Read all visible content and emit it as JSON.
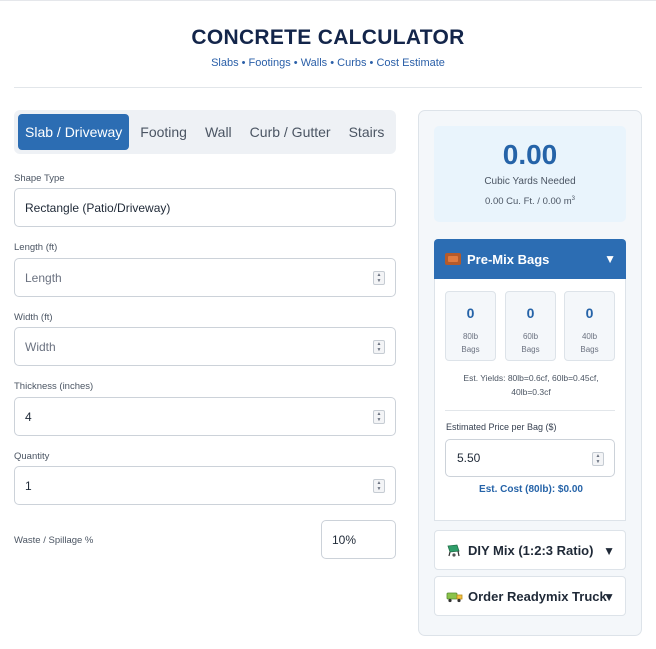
{
  "header": {
    "title": "CONCRETE CALCULATOR",
    "subtitle": "Slabs • Footings • Walls • Curbs • Cost Estimate"
  },
  "tabs": [
    {
      "label": "Slab / Driveway",
      "active": true
    },
    {
      "label": "Footing",
      "active": false
    },
    {
      "label": "Wall",
      "active": false
    },
    {
      "label": "Curb / Gutter",
      "active": false
    },
    {
      "label": "Stairs",
      "active": false
    }
  ],
  "form": {
    "shape_type": {
      "label": "Shape Type",
      "value": "Rectangle (Patio/Driveway)"
    },
    "length": {
      "label": "Length (ft)",
      "placeholder": "Length",
      "value": ""
    },
    "width": {
      "label": "Width (ft)",
      "placeholder": "Width",
      "value": ""
    },
    "thickness": {
      "label": "Thickness (inches)",
      "value": "4"
    },
    "quantity": {
      "label": "Quantity",
      "value": "1"
    },
    "waste": {
      "label": "Waste / Spillage %",
      "value": "10%"
    }
  },
  "result": {
    "value": "0.00",
    "unit": "Cubic Yards Needed",
    "sub_prefix": "0.00 Cu. Ft. / 0.00 m",
    "sub_exp": "3"
  },
  "premix": {
    "title": "Pre-Mix Bags",
    "bags": [
      {
        "count": "0",
        "label1": "80lb",
        "label2": "Bags"
      },
      {
        "count": "0",
        "label1": "60lb",
        "label2": "Bags"
      },
      {
        "count": "0",
        "label1": "40lb",
        "label2": "Bags"
      }
    ],
    "yields_line1": "Est. Yields: 80lb=0.6cf, 60lb=0.45cf,",
    "yields_line2": "40lb=0.3cf",
    "price_label": "Estimated Price per Bag ($)",
    "price_value": "5.50",
    "est_cost": "Est. Cost (80lb): $0.00"
  },
  "diy": {
    "title": "DIY Mix (1:2:3 Ratio)"
  },
  "readymix": {
    "title": "Order Readymix Truck"
  },
  "arrows": {
    "down": "▼"
  },
  "colors": {
    "accent": "#2c6db3",
    "title": "#13254a",
    "result": "#2563a8"
  }
}
